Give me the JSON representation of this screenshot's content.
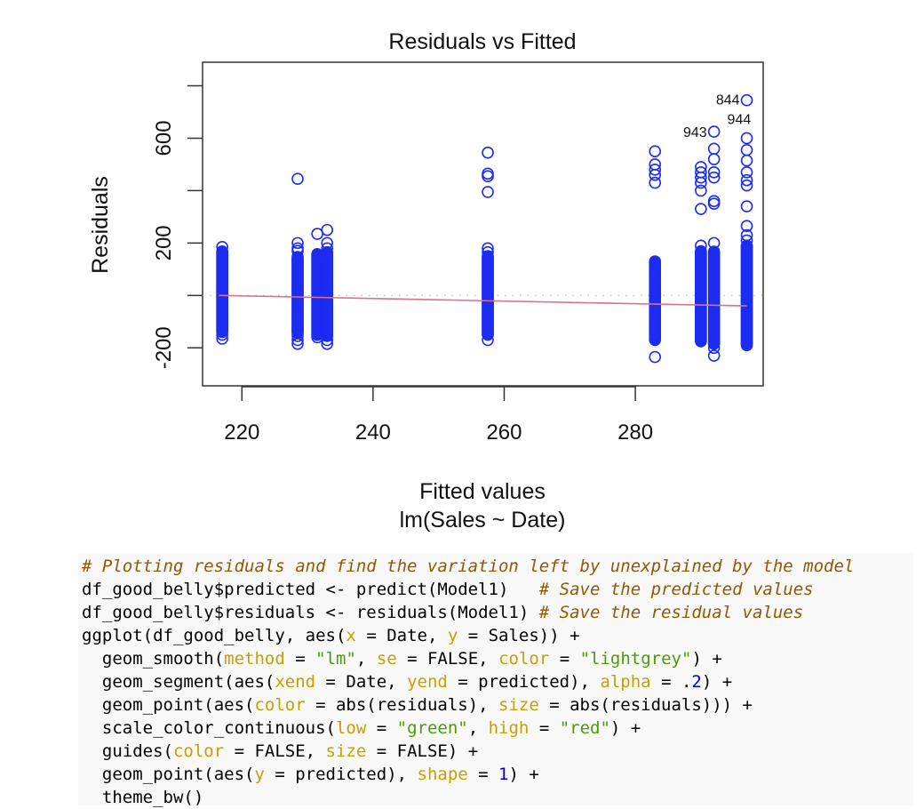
{
  "chart_data": {
    "type": "scatter",
    "title": "Residuals vs Fitted",
    "xlabel": "Fitted values",
    "sublabel": "lm(Sales ~ Date)",
    "ylabel": "Residuals",
    "xlim": [
      214,
      299.5
    ],
    "ylim": [
      -345,
      890
    ],
    "x_ticks": [
      220,
      240,
      260,
      280
    ],
    "y_ticks": [
      -200,
      0,
      200,
      400,
      600,
      800
    ],
    "y_tick_labels": [
      "-200",
      "",
      "200",
      "",
      "600",
      ""
    ],
    "point_color": "#1c2cf0",
    "smooth_color": "#d9738a",
    "zero_line_color": "#b0b0b0",
    "clusters": [
      {
        "fitted": 217.0,
        "dense_min": -140,
        "dense_max": 170,
        "extra": [
          185,
          -165,
          -150
        ]
      },
      {
        "fitted": 228.5,
        "dense_min": -145,
        "dense_max": 150,
        "extra": [
          445,
          200,
          180,
          170,
          -155,
          -170,
          -185
        ]
      },
      {
        "fitted": 231.5,
        "dense_min": -150,
        "dense_max": 160,
        "extra": [
          235,
          -160,
          -150
        ]
      },
      {
        "fitted": 233.0,
        "dense_min": -155,
        "dense_max": 165,
        "extra": [
          250,
          200,
          180,
          -185,
          -170
        ]
      },
      {
        "fitted": 257.5,
        "dense_min": -150,
        "dense_max": 150,
        "extra": [
          545,
          465,
          455,
          395,
          180,
          165,
          -170
        ]
      },
      {
        "fitted": 283.0,
        "dense_min": -170,
        "dense_max": 130,
        "extra": [
          550,
          500,
          480,
          460,
          430,
          -235
        ]
      },
      {
        "fitted": 290.0,
        "dense_min": -175,
        "dense_max": 170,
        "extra": [
          490,
          470,
          450,
          430,
          400,
          330,
          190
        ]
      },
      {
        "fitted": 292.0,
        "dense_min": -185,
        "dense_max": 170,
        "extra": [
          625,
          560,
          520,
          470,
          450,
          360,
          350,
          200,
          -200,
          -230
        ]
      },
      {
        "fitted": 297.0,
        "dense_min": -190,
        "dense_max": 190,
        "extra": [
          745,
          600,
          555,
          515,
          470,
          440,
          420,
          340,
          265,
          230,
          210,
          -180
        ]
      }
    ],
    "labeled_points": [
      {
        "label": "844",
        "fitted": 297.0,
        "residual": 745
      },
      {
        "label": "944",
        "fitted": 297.0,
        "residual": 640
      },
      {
        "label": "943",
        "fitted": 292.0,
        "residual": 625
      }
    ],
    "smooth_line": [
      {
        "fitted": 216.5,
        "residual": 0
      },
      {
        "fitted": 297.0,
        "residual": -40
      }
    ]
  },
  "code": {
    "lines": [
      [
        {
          "t": "comment",
          "v": "# Plotting residuals and find the variation left by unexplained by the model"
        }
      ],
      [
        {
          "t": "plain",
          "v": "df_good_belly$predicted <- predict(Model1)   "
        },
        {
          "t": "comment",
          "v": "# Save the predicted values"
        }
      ],
      [
        {
          "t": "plain",
          "v": "df_good_belly$residuals <- residuals(Model1) "
        },
        {
          "t": "comment",
          "v": "# Save the residual values"
        }
      ],
      [
        {
          "t": "plain",
          "v": "ggplot(df_good_belly, aes("
        },
        {
          "t": "arg",
          "v": "x"
        },
        {
          "t": "plain",
          "v": " = Date, "
        },
        {
          "t": "arg",
          "v": "y"
        },
        {
          "t": "plain",
          "v": " = Sales)) +"
        }
      ],
      [
        {
          "t": "plain",
          "v": "  geom_smooth("
        },
        {
          "t": "arg",
          "v": "method"
        },
        {
          "t": "plain",
          "v": " = "
        },
        {
          "t": "str",
          "v": "\"lm\""
        },
        {
          "t": "plain",
          "v": ", "
        },
        {
          "t": "arg",
          "v": "se"
        },
        {
          "t": "plain",
          "v": " = FALSE, "
        },
        {
          "t": "arg",
          "v": "color"
        },
        {
          "t": "plain",
          "v": " = "
        },
        {
          "t": "str",
          "v": "\"lightgrey\""
        },
        {
          "t": "plain",
          "v": ") +"
        }
      ],
      [
        {
          "t": "plain",
          "v": "  geom_segment(aes("
        },
        {
          "t": "arg",
          "v": "xend"
        },
        {
          "t": "plain",
          "v": " = Date, "
        },
        {
          "t": "arg",
          "v": "yend"
        },
        {
          "t": "plain",
          "v": " = predicted), "
        },
        {
          "t": "arg",
          "v": "alpha"
        },
        {
          "t": "plain",
          "v": " = ."
        },
        {
          "t": "num",
          "v": "2"
        },
        {
          "t": "plain",
          "v": ") +"
        }
      ],
      [
        {
          "t": "plain",
          "v": "  geom_point(aes("
        },
        {
          "t": "arg",
          "v": "color"
        },
        {
          "t": "plain",
          "v": " = abs(residuals), "
        },
        {
          "t": "arg",
          "v": "size"
        },
        {
          "t": "plain",
          "v": " = abs(residuals))) +"
        }
      ],
      [
        {
          "t": "plain",
          "v": "  scale_color_continuous("
        },
        {
          "t": "arg",
          "v": "low"
        },
        {
          "t": "plain",
          "v": " = "
        },
        {
          "t": "str",
          "v": "\"green\""
        },
        {
          "t": "plain",
          "v": ", "
        },
        {
          "t": "arg",
          "v": "high"
        },
        {
          "t": "plain",
          "v": " = "
        },
        {
          "t": "str",
          "v": "\"red\""
        },
        {
          "t": "plain",
          "v": ") +"
        }
      ],
      [
        {
          "t": "plain",
          "v": "  guides("
        },
        {
          "t": "arg",
          "v": "color"
        },
        {
          "t": "plain",
          "v": " = FALSE, "
        },
        {
          "t": "arg",
          "v": "size"
        },
        {
          "t": "plain",
          "v": " = FALSE) +"
        }
      ],
      [
        {
          "t": "plain",
          "v": "  geom_point(aes("
        },
        {
          "t": "arg",
          "v": "y"
        },
        {
          "t": "plain",
          "v": " = predicted), "
        },
        {
          "t": "arg",
          "v": "shape"
        },
        {
          "t": "plain",
          "v": " = "
        },
        {
          "t": "num",
          "v": "1"
        },
        {
          "t": "plain",
          "v": ") +"
        }
      ],
      [
        {
          "t": "plain",
          "v": "  theme_bw()"
        }
      ]
    ]
  }
}
